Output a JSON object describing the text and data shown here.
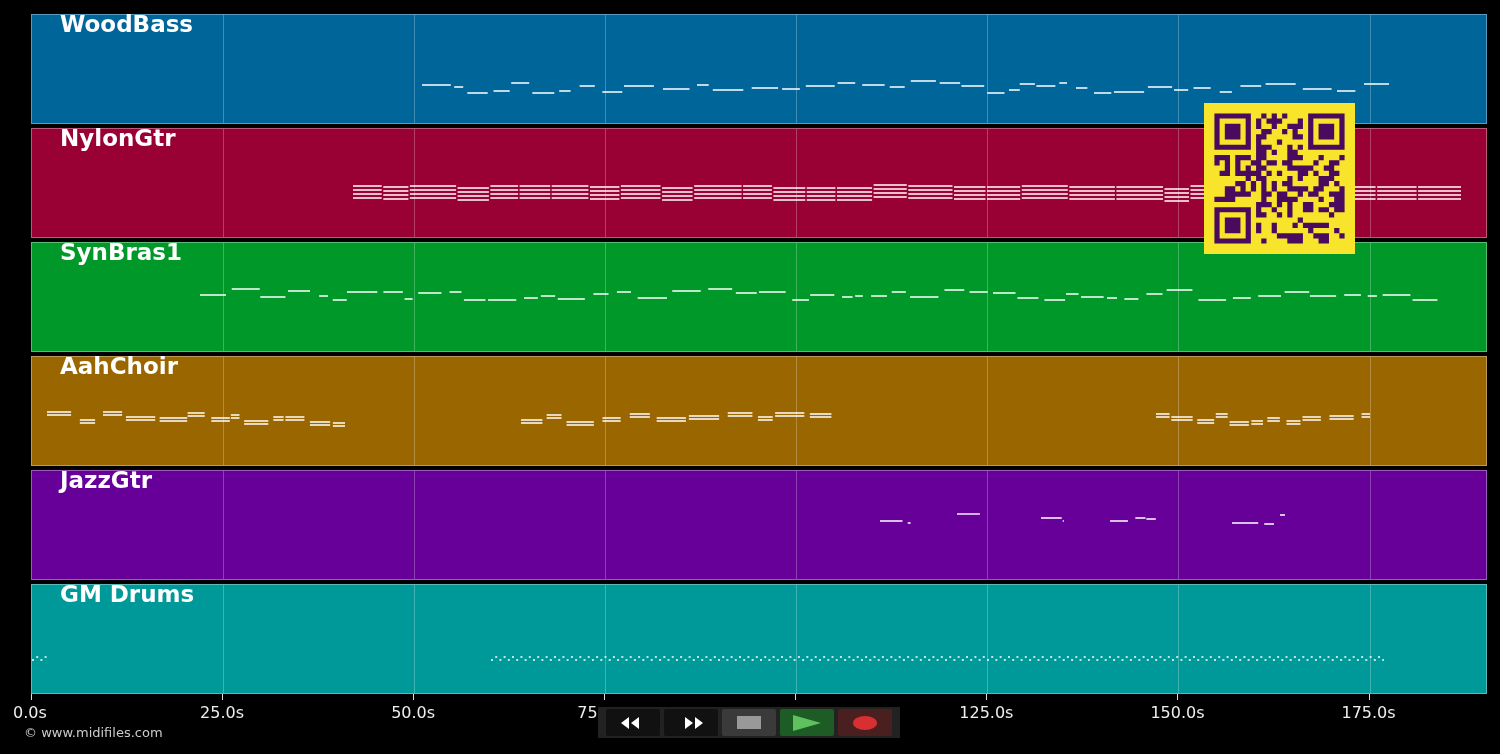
{
  "tracks": [
    {
      "name": "WoodBass",
      "color": "#00669a"
    },
    {
      "name": "NylonGtr",
      "color": "#990033"
    },
    {
      "name": "SynBras1",
      "color": "#009929"
    },
    {
      "name": "AahChoir",
      "color": "#996600"
    },
    {
      "name": "JazzGtr",
      "color": "#660099"
    },
    {
      "name": "GM Drums",
      "color": "#009999"
    }
  ],
  "time_axis": {
    "ticks": [
      "0.0s",
      "25.0s",
      "50.0s",
      "75",
      "125.0s",
      "150.0s",
      "175.0s"
    ]
  },
  "credit": "© www.midifiles.com"
}
